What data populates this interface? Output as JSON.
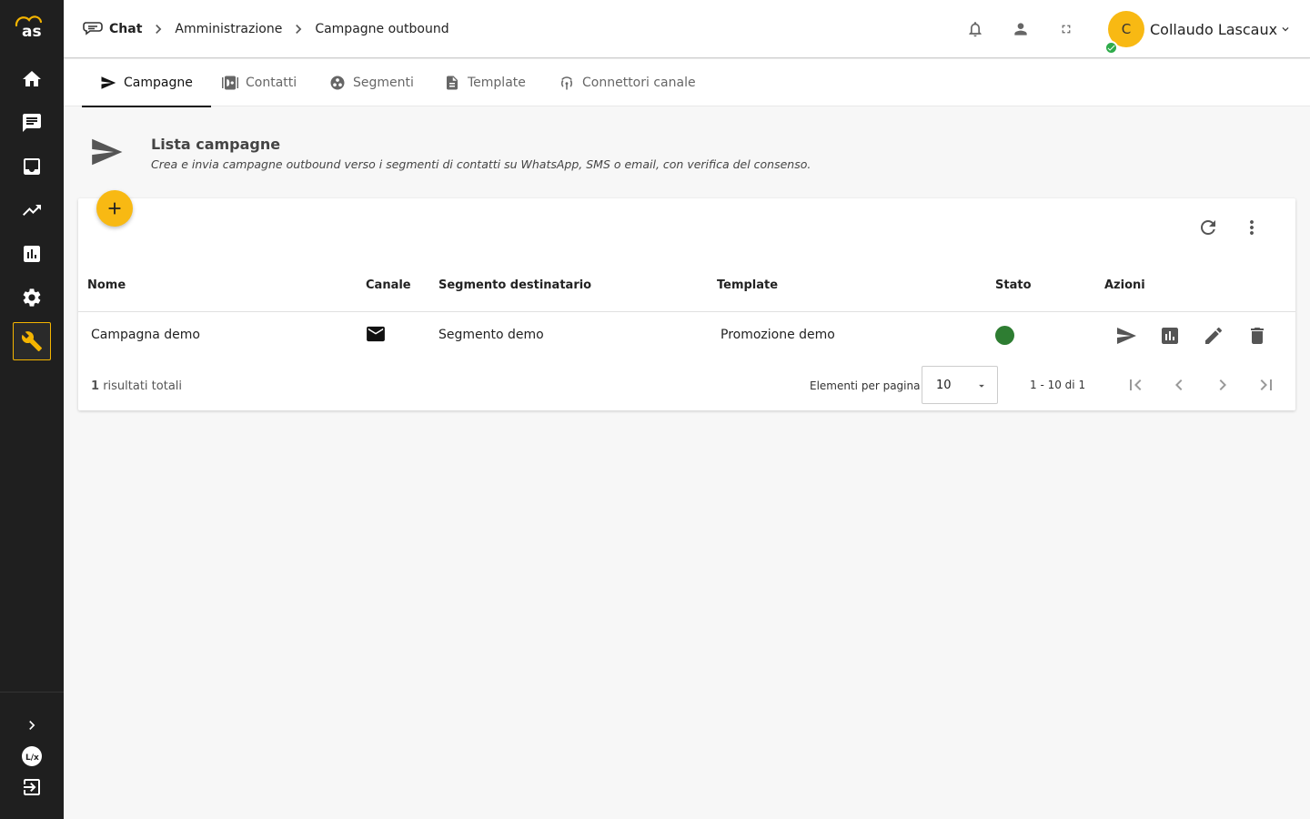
{
  "breadcrumb": {
    "items": [
      "Chat",
      "Amministrazione",
      "Campagne outbound"
    ]
  },
  "user": {
    "initial": "C",
    "name": "Collaudo Lascaux"
  },
  "tabs": [
    {
      "label": "Campagne",
      "icon": "send-icon",
      "active": true
    },
    {
      "label": "Contatti",
      "icon": "contacts-icon"
    },
    {
      "label": "Segmenti",
      "icon": "segments-icon"
    },
    {
      "label": "Template",
      "icon": "document-icon"
    },
    {
      "label": "Connettori canale",
      "icon": "antenna-icon"
    }
  ],
  "page": {
    "title": "Lista campagne",
    "subtitle": "Crea e invia campagne outbound verso i segmenti di contatti su WhatsApp, SMS o email, con verifica del consenso."
  },
  "table": {
    "columns": [
      "Nome",
      "Canale",
      "Segmento destinatario",
      "Template",
      "Stato",
      "Azioni"
    ],
    "rows": [
      {
        "name": "Campagna demo",
        "channel_icon": "email-icon",
        "segment": "Segmento demo",
        "template": "Promozione demo",
        "status_color": "#2e7d32"
      }
    ]
  },
  "footer": {
    "total_count": "1",
    "total_label": "risultati totali",
    "per_page_label": "Elementi per pagina",
    "per_page_value": "10",
    "range": "1 - 10 di 1"
  },
  "colors": {
    "accent": "#f8b913",
    "sidebar": "#1f1f1f",
    "status_active": "#2e7d32"
  }
}
